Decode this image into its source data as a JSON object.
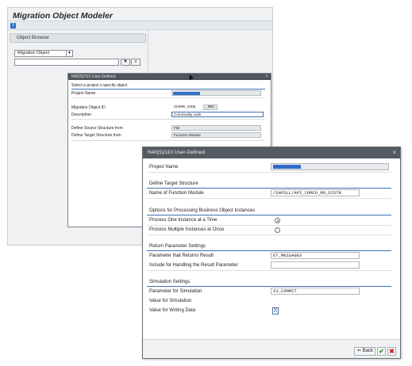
{
  "main": {
    "title": "Migration Object Modeler",
    "info_icon": "i",
    "object_browser_label": "Object Browser",
    "dropdown_value": "Migration Object",
    "dropdown_caret": "▼",
    "search_input_value": "",
    "execute_icon_glyph": "▼",
    "binoculars_glyph": "⌕"
  },
  "dialog1": {
    "title": "N40(5)/110 User-Defined",
    "close_glyph": "×",
    "heading": "Select a project o specify object",
    "project_name_label": "Project Name",
    "migration_object_id_label": "Migration Object ID",
    "migration_object_id_value": "ZCOMM_CODE",
    "migration_object_suffix": "_001",
    "description_label": "Description",
    "description_value": "Commodity code",
    "define_source_label": "Define Source Structure from",
    "define_source_value": "File",
    "define_target_label": "Define Target Structure from",
    "define_target_value": "Function Module"
  },
  "dialog2": {
    "title": "N40(5)/110 User-Defined",
    "close_glyph": "×",
    "project_name_label": "Project Name",
    "section_define_target": "Define Target Structure",
    "function_module_label": "Name of Function Module",
    "function_module_value": "/SAPSLL/API_COMCO_MD_DISTR",
    "section_options": "Options for Processing Business Object Instances",
    "option_one_label": "Process One Instance at a Time",
    "option_multi_label": "Process Multiple Instances at Once",
    "section_return": "Return Parameter Settings",
    "return_param_label": "Parameter that Returns Result",
    "return_param_value": "ET_MESSAGES",
    "include_label": "Include for Handling the Result Parameter",
    "include_value": "",
    "section_simulation": "Simulation Settings",
    "sim_param_label": "Parameter for Simulation",
    "sim_param_value": "IV_COMMIT",
    "sim_value_label": "Value for Simulation",
    "writing_value_label": "Value for Writing Data",
    "writing_value_checked": "X",
    "back_label": "Back",
    "ok_glyph": "✔",
    "cancel_glyph": "✖"
  }
}
